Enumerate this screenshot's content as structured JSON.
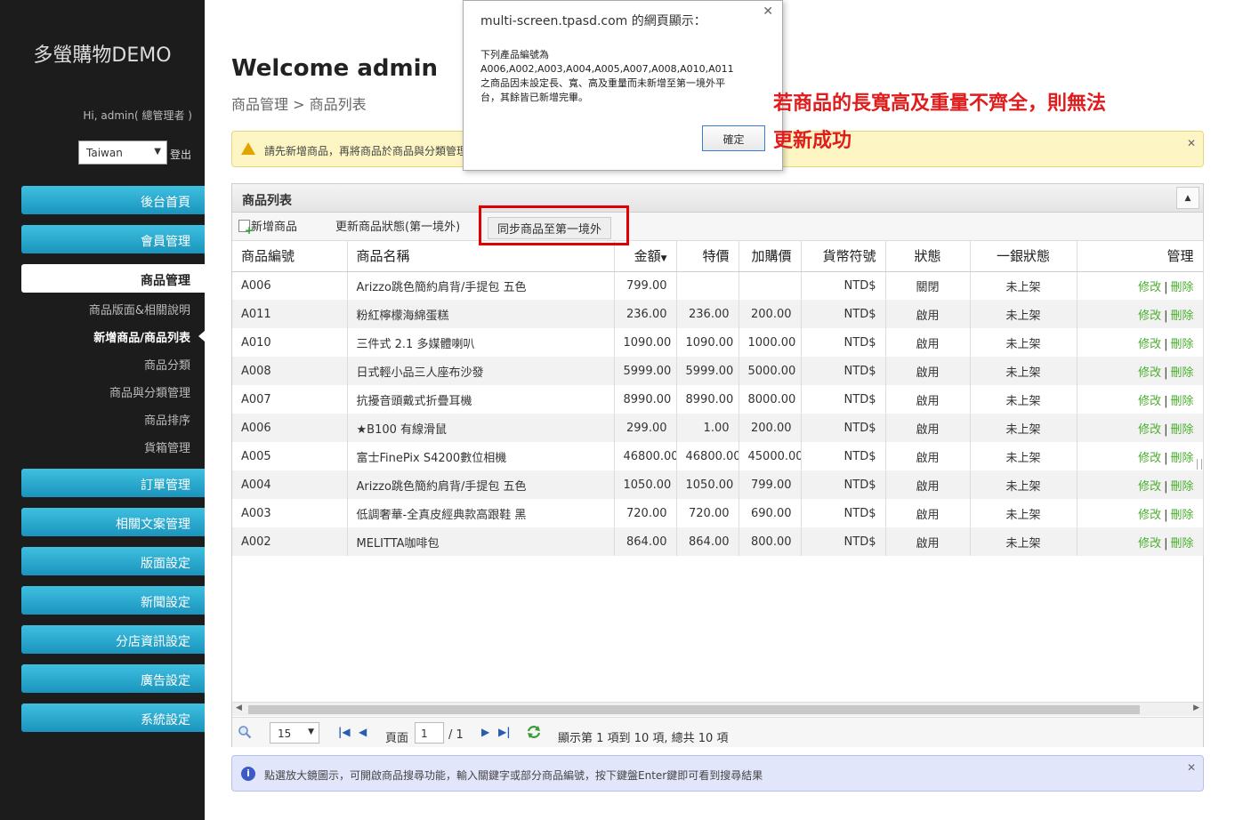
{
  "sidebar": {
    "brand": "多螢購物DEMO",
    "greeting": "Hi, admin( 總管理者 )",
    "language": "Taiwan",
    "logout": "登出",
    "nav": {
      "home": "後台首頁",
      "members": "會員管理",
      "products": "商品管理",
      "orders": "訂單管理",
      "docs": "相關文案管理",
      "layout": "版面設定",
      "news": "新聞設定",
      "stores": "分店資訊設定",
      "ads": "廣告設定",
      "system": "系統設定"
    },
    "subitems": [
      "商品版面&相關說明",
      "新增商品/商品列表",
      "商品分類",
      "商品與分類管理",
      "商品排序",
      "貨箱管理"
    ]
  },
  "main": {
    "welcome": "Welcome admin",
    "breadcrumb": "商品管理 > 商品列表",
    "warning": "請先新增商品，再將商品於商品與分類管理"
  },
  "grid": {
    "title": "商品列表",
    "toolbar": {
      "add": "新增商品",
      "update_status": "更新商品狀態(第一境外)",
      "sync": "同步商品至第一境外"
    },
    "columns": [
      "商品編號",
      "商品名稱",
      "金額",
      "特價",
      "加購價",
      "貨幣符號",
      "狀態",
      "一銀狀態",
      "管理"
    ],
    "rows": [
      [
        "A006",
        "Arizzo跳色簡約肩背/手提包 五色",
        "799.00",
        "",
        "",
        "NTD$",
        "關閉",
        "未上架"
      ],
      [
        "A011",
        "粉紅檸檬海綿蛋糕",
        "236.00",
        "236.00",
        "200.00",
        "NTD$",
        "啟用",
        "未上架"
      ],
      [
        "A010",
        "三件式 2.1 多媒體喇叭",
        "1090.00",
        "1090.00",
        "1000.00",
        "NTD$",
        "啟用",
        "未上架"
      ],
      [
        "A008",
        "日式輕小品三人座布沙發",
        "5999.00",
        "5999.00",
        "5000.00",
        "NTD$",
        "啟用",
        "未上架"
      ],
      [
        "A007",
        "抗擾音頭戴式折疊耳機",
        "8990.00",
        "8990.00",
        "8000.00",
        "NTD$",
        "啟用",
        "未上架"
      ],
      [
        "A006",
        "★B100 有線滑鼠",
        "299.00",
        "1.00",
        "200.00",
        "NTD$",
        "啟用",
        "未上架"
      ],
      [
        "A005",
        "富士FinePix S4200數位相機",
        "46800.00",
        "46800.00",
        "45000.00",
        "NTD$",
        "啟用",
        "未上架"
      ],
      [
        "A004",
        "Arizzo跳色簡約肩背/手提包 五色",
        "1050.00",
        "1050.00",
        "799.00",
        "NTD$",
        "啟用",
        "未上架"
      ],
      [
        "A003",
        "低調奢華-全真皮經典款高跟鞋 黑",
        "720.00",
        "720.00",
        "690.00",
        "NTD$",
        "啟用",
        "未上架"
      ],
      [
        "A002",
        "MELITTA咖啡包",
        "864.00",
        "864.00",
        "800.00",
        "NTD$",
        "啟用",
        "未上架"
      ]
    ],
    "edit_label": "修改",
    "delete_label": "刪除",
    "pager": {
      "page_size": "15",
      "page_label": "頁面",
      "page_value": "1",
      "total_pages": "/ 1",
      "summary": "顯示第 1 項到 10 項, 總共 10 項"
    }
  },
  "info_bar": "點選放大鏡圖示，可開啟商品搜尋功能，輸入關鍵字或部分商品編號，按下鍵盤Enter鍵即可看到搜尋結果",
  "dialog": {
    "title": "multi-screen.tpasd.com 的網頁顯示：",
    "body": "下列產品編號為\nA006,A002,A003,A004,A005,A007,A008,A010,A011\n之商品因未設定長、寬、高及重量而未新增至第一境外平\n台，其餘皆已新增完畢。",
    "ok": "確定"
  },
  "annotation": {
    "line1": "若商品的長寬高及重量不齊全，則無法",
    "line2": "更新成功",
    "color": "#e01c1c"
  },
  "icons": {
    "close": "close-icon",
    "warning": "warning-icon",
    "info": "info-icon",
    "search": "magnifier-icon",
    "refresh": "refresh-icon"
  },
  "colors": {
    "sidebar_bg": "#1c1c1c",
    "nav_button": "#2aa7d0",
    "action_link": "#4ab02c",
    "warning_bg": "#fdf6c4",
    "info_bg": "#e2e6fb"
  }
}
